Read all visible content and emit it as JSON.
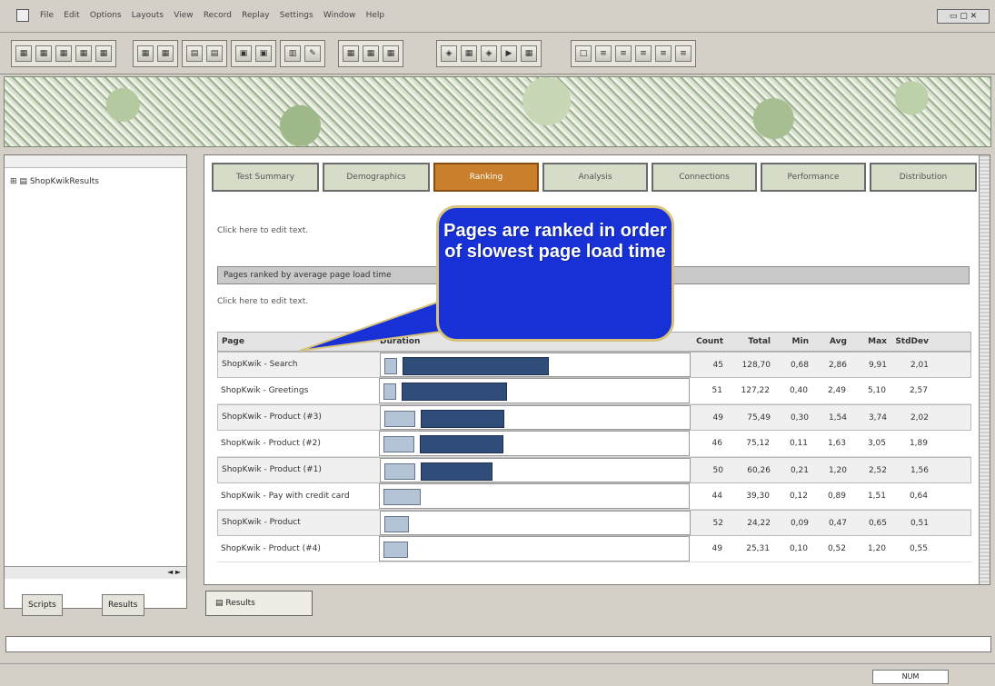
{
  "menubar": {
    "items": [
      "File",
      "Edit",
      "Options",
      "Layouts",
      "View",
      "Record",
      "Replay",
      "Settings",
      "Window",
      "Help"
    ]
  },
  "toolbar": {
    "groups": [
      {
        "buttons": [
          "▦",
          "▦",
          "▦",
          "▦",
          "▦"
        ]
      },
      {
        "buttons": [
          "▦",
          "▦"
        ]
      },
      {
        "buttons": [
          "▤",
          "▤"
        ]
      },
      {
        "buttons": [
          "▣",
          "▣"
        ]
      },
      {
        "buttons": [
          "▥",
          "✎"
        ]
      },
      {
        "buttons": [
          "▦",
          "▦",
          "▦"
        ]
      },
      {
        "buttons": [
          "◈",
          "▦",
          "◈",
          "▶",
          "▦"
        ]
      },
      {
        "buttons": [
          "□",
          "≡",
          "≡",
          "≡",
          "≡",
          "≡"
        ]
      }
    ]
  },
  "tree": {
    "root_label": "ShopKwikResults"
  },
  "left_tabs": [
    "Scripts",
    "Results"
  ],
  "main": {
    "tabs": [
      "Test Summary",
      "Demographics",
      "Ranking",
      "Analysis",
      "Connections",
      "Performance",
      "Distribution"
    ],
    "edit_text_1": "Click here to edit text.",
    "section_title": "Pages ranked by average page load time",
    "edit_text_2": "Click here to edit text.",
    "columns": {
      "page": "Page",
      "graph": "Duration",
      "count": "Count",
      "total": "Total",
      "min": "Min",
      "avg": "Avg",
      "max": "Max",
      "stdev": "StdDev"
    },
    "rows": [
      {
        "page": "ShopKwik - Search",
        "count": "45",
        "total": "128,70",
        "min": "0,68",
        "avg": "2,86",
        "max": "9,91",
        "stdev": "2,01"
      },
      {
        "page": "ShopKwik - Greetings",
        "count": "51",
        "total": "127,22",
        "min": "0,40",
        "avg": "2,49",
        "max": "5,10",
        "stdev": "2,57"
      },
      {
        "page": "ShopKwik - Product (#3)",
        "count": "49",
        "total": "75,49",
        "min": "0,30",
        "avg": "1,54",
        "max": "3,74",
        "stdev": "2,02"
      },
      {
        "page": "ShopKwik - Product (#2)",
        "count": "46",
        "total": "75,12",
        "min": "0,11",
        "avg": "1,63",
        "max": "3,05",
        "stdev": "1,89"
      },
      {
        "page": "ShopKwik - Product (#1)",
        "count": "50",
        "total": "60,26",
        "min": "0,21",
        "avg": "1,20",
        "max": "2,52",
        "stdev": "1,56"
      },
      {
        "page": "ShopKwik - Pay with credit card",
        "count": "44",
        "total": "39,30",
        "min": "0,12",
        "avg": "0,89",
        "max": "1,51",
        "stdev": "0,64"
      },
      {
        "page": "ShopKwik - Product",
        "count": "52",
        "total": "24,22",
        "min": "0,09",
        "avg": "0,47",
        "max": "0,65",
        "stdev": "0,51"
      },
      {
        "page": "ShopKwik - Product (#4)",
        "count": "49",
        "total": "25,31",
        "min": "0,10",
        "avg": "0,52",
        "max": "1,20",
        "stdev": "0,55"
      }
    ],
    "bars": [
      {
        "light": 0.04,
        "dark": 0.47
      },
      {
        "light": 0.04,
        "dark": 0.34
      },
      {
        "light": 0.1,
        "dark": 0.27
      },
      {
        "light": 0.1,
        "dark": 0.27
      },
      {
        "light": 0.1,
        "dark": 0.23
      },
      {
        "light": 0.12,
        "dark": 0.0
      },
      {
        "light": 0.08,
        "dark": 0.0
      },
      {
        "light": 0.08,
        "dark": 0.0
      }
    ]
  },
  "callout": {
    "text": "Pages are ranked in order of slowest page load time"
  },
  "doc_tab": {
    "label": "Results"
  },
  "status": {
    "text": "NUM"
  },
  "window_controls": "▭ ▢ ✕"
}
